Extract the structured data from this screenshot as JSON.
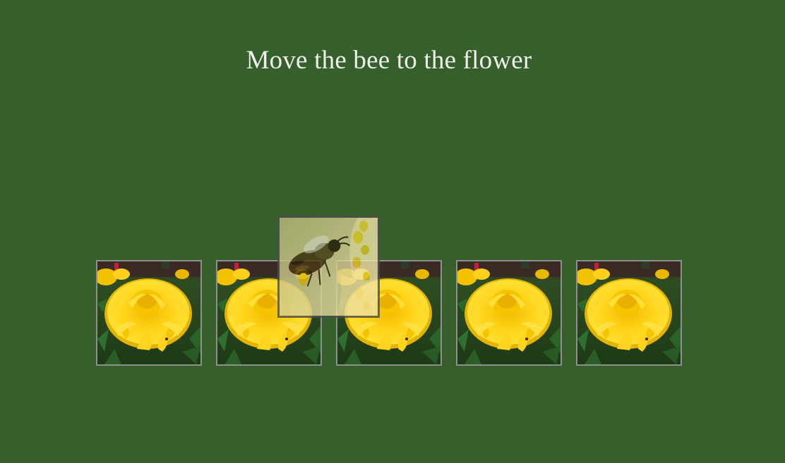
{
  "prompt": {
    "title": "Move the bee to the flower"
  },
  "flowers": [
    {
      "icon": "marigold-flower-image"
    },
    {
      "icon": "marigold-flower-image"
    },
    {
      "icon": "marigold-flower-image"
    },
    {
      "icon": "marigold-flower-image"
    },
    {
      "icon": "marigold-flower-image"
    }
  ],
  "bee": {
    "icon": "bee-on-flower-image"
  },
  "colors": {
    "background": "#365f2c",
    "title_text": "#ecf0e8",
    "tile_border": "#8f8f8f",
    "bee_tile_border": "#4d4d4d"
  }
}
